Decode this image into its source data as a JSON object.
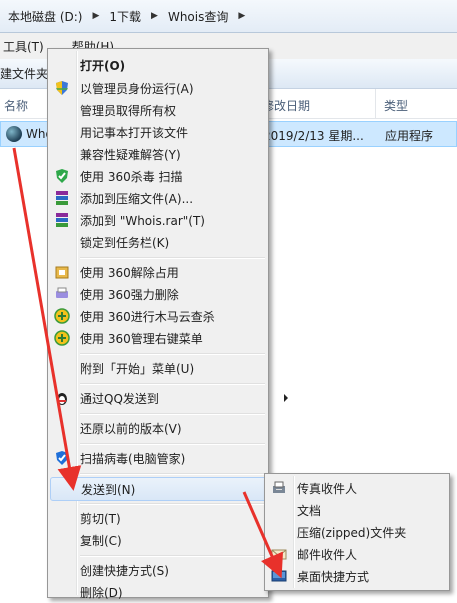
{
  "address": {
    "crumbs": [
      "本地磁盘 (D:)",
      "1下载",
      "Whois查询"
    ]
  },
  "menubar": {
    "tools": "工具(T)",
    "help": "帮助(H)"
  },
  "toolbar": {
    "new_folder": "建文件夹"
  },
  "columns": {
    "name": "名称",
    "modified": "修改日期",
    "type": "类型"
  },
  "file": {
    "name": "Whois",
    "modified": "2019/2/13 星期...",
    "type": "应用程序"
  },
  "context_menu": {
    "open": "打开(O)",
    "run_as_admin": "以管理员身份运行(A)",
    "take_ownership": "管理员取得所有权",
    "open_notepad": "用记事本打开该文件",
    "compat": "兼容性疑难解答(Y)",
    "scan360": "使用 360杀毒 扫描",
    "add_archive": "添加到压缩文件(A)...",
    "add_rar": "添加到 \"Whois.rar\"(T)",
    "pin_taskbar": "锁定到任务栏(K)",
    "unlock360": "使用 360解除占用",
    "force_delete360": "使用 360强力删除",
    "trojan_scan360": "使用 360进行木马云查杀",
    "manage360": "使用 360管理右键菜单",
    "pin_start": "附到「开始」菜单(U)",
    "send_qq": "通过QQ发送到",
    "restore": "还原以前的版本(V)",
    "virus_scan": "扫描病毒(电脑管家)",
    "send_to": "发送到(N)",
    "cut": "剪切(T)",
    "copy": "复制(C)",
    "create_shortcut": "创建快捷方式(S)",
    "delete": "删除(D)"
  },
  "send_to_menu": {
    "fax": "传真收件人",
    "documents": "文档",
    "zip": "压缩(zipped)文件夹",
    "mail": "邮件收件人",
    "desktop": "桌面快捷方式"
  },
  "colors": {
    "annotation": "#e8312b",
    "highlight": "#cde8ff"
  }
}
